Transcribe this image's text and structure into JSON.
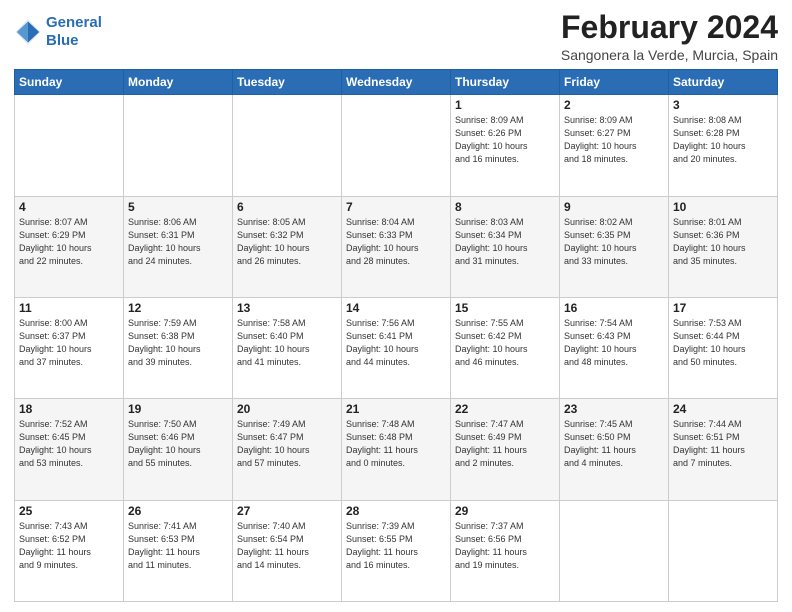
{
  "header": {
    "logo_line1": "General",
    "logo_line2": "Blue",
    "month": "February 2024",
    "location": "Sangonera la Verde, Murcia, Spain"
  },
  "weekdays": [
    "Sunday",
    "Monday",
    "Tuesday",
    "Wednesday",
    "Thursday",
    "Friday",
    "Saturday"
  ],
  "weeks": [
    [
      {
        "day": "",
        "info": ""
      },
      {
        "day": "",
        "info": ""
      },
      {
        "day": "",
        "info": ""
      },
      {
        "day": "",
        "info": ""
      },
      {
        "day": "1",
        "info": "Sunrise: 8:09 AM\nSunset: 6:26 PM\nDaylight: 10 hours\nand 16 minutes."
      },
      {
        "day": "2",
        "info": "Sunrise: 8:09 AM\nSunset: 6:27 PM\nDaylight: 10 hours\nand 18 minutes."
      },
      {
        "day": "3",
        "info": "Sunrise: 8:08 AM\nSunset: 6:28 PM\nDaylight: 10 hours\nand 20 minutes."
      }
    ],
    [
      {
        "day": "4",
        "info": "Sunrise: 8:07 AM\nSunset: 6:29 PM\nDaylight: 10 hours\nand 22 minutes."
      },
      {
        "day": "5",
        "info": "Sunrise: 8:06 AM\nSunset: 6:31 PM\nDaylight: 10 hours\nand 24 minutes."
      },
      {
        "day": "6",
        "info": "Sunrise: 8:05 AM\nSunset: 6:32 PM\nDaylight: 10 hours\nand 26 minutes."
      },
      {
        "day": "7",
        "info": "Sunrise: 8:04 AM\nSunset: 6:33 PM\nDaylight: 10 hours\nand 28 minutes."
      },
      {
        "day": "8",
        "info": "Sunrise: 8:03 AM\nSunset: 6:34 PM\nDaylight: 10 hours\nand 31 minutes."
      },
      {
        "day": "9",
        "info": "Sunrise: 8:02 AM\nSunset: 6:35 PM\nDaylight: 10 hours\nand 33 minutes."
      },
      {
        "day": "10",
        "info": "Sunrise: 8:01 AM\nSunset: 6:36 PM\nDaylight: 10 hours\nand 35 minutes."
      }
    ],
    [
      {
        "day": "11",
        "info": "Sunrise: 8:00 AM\nSunset: 6:37 PM\nDaylight: 10 hours\nand 37 minutes."
      },
      {
        "day": "12",
        "info": "Sunrise: 7:59 AM\nSunset: 6:38 PM\nDaylight: 10 hours\nand 39 minutes."
      },
      {
        "day": "13",
        "info": "Sunrise: 7:58 AM\nSunset: 6:40 PM\nDaylight: 10 hours\nand 41 minutes."
      },
      {
        "day": "14",
        "info": "Sunrise: 7:56 AM\nSunset: 6:41 PM\nDaylight: 10 hours\nand 44 minutes."
      },
      {
        "day": "15",
        "info": "Sunrise: 7:55 AM\nSunset: 6:42 PM\nDaylight: 10 hours\nand 46 minutes."
      },
      {
        "day": "16",
        "info": "Sunrise: 7:54 AM\nSunset: 6:43 PM\nDaylight: 10 hours\nand 48 minutes."
      },
      {
        "day": "17",
        "info": "Sunrise: 7:53 AM\nSunset: 6:44 PM\nDaylight: 10 hours\nand 50 minutes."
      }
    ],
    [
      {
        "day": "18",
        "info": "Sunrise: 7:52 AM\nSunset: 6:45 PM\nDaylight: 10 hours\nand 53 minutes."
      },
      {
        "day": "19",
        "info": "Sunrise: 7:50 AM\nSunset: 6:46 PM\nDaylight: 10 hours\nand 55 minutes."
      },
      {
        "day": "20",
        "info": "Sunrise: 7:49 AM\nSunset: 6:47 PM\nDaylight: 10 hours\nand 57 minutes."
      },
      {
        "day": "21",
        "info": "Sunrise: 7:48 AM\nSunset: 6:48 PM\nDaylight: 11 hours\nand 0 minutes."
      },
      {
        "day": "22",
        "info": "Sunrise: 7:47 AM\nSunset: 6:49 PM\nDaylight: 11 hours\nand 2 minutes."
      },
      {
        "day": "23",
        "info": "Sunrise: 7:45 AM\nSunset: 6:50 PM\nDaylight: 11 hours\nand 4 minutes."
      },
      {
        "day": "24",
        "info": "Sunrise: 7:44 AM\nSunset: 6:51 PM\nDaylight: 11 hours\nand 7 minutes."
      }
    ],
    [
      {
        "day": "25",
        "info": "Sunrise: 7:43 AM\nSunset: 6:52 PM\nDaylight: 11 hours\nand 9 minutes."
      },
      {
        "day": "26",
        "info": "Sunrise: 7:41 AM\nSunset: 6:53 PM\nDaylight: 11 hours\nand 11 minutes."
      },
      {
        "day": "27",
        "info": "Sunrise: 7:40 AM\nSunset: 6:54 PM\nDaylight: 11 hours\nand 14 minutes."
      },
      {
        "day": "28",
        "info": "Sunrise: 7:39 AM\nSunset: 6:55 PM\nDaylight: 11 hours\nand 16 minutes."
      },
      {
        "day": "29",
        "info": "Sunrise: 7:37 AM\nSunset: 6:56 PM\nDaylight: 11 hours\nand 19 minutes."
      },
      {
        "day": "",
        "info": ""
      },
      {
        "day": "",
        "info": ""
      }
    ]
  ]
}
